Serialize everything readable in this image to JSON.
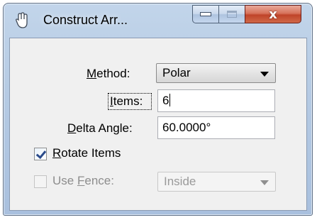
{
  "window": {
    "title": "Construct Arr...",
    "close_glyph": "x"
  },
  "form": {
    "method_label": "ethod:",
    "method_label_mnemonic": "M",
    "method_value": "Polar",
    "items_label": "tems:",
    "items_label_mnemonic": "I",
    "items_value": "6",
    "delta_label": "elta Angle:",
    "delta_label_mnemonic": "D",
    "delta_value": "60.0000°",
    "rotate_label": "otate Items",
    "rotate_label_mnemonic": "R",
    "rotate_checked": true,
    "fence_label_prefix": "Use ",
    "fence_label_mnemonic": "F",
    "fence_label_suffix": "ence:",
    "fence_checked": false,
    "fence_value": "Inside"
  },
  "icons": {
    "app": "hand-icon",
    "minimize": "minimize-icon",
    "maximize": "maximize-icon",
    "close": "close-icon",
    "dropdown": "chevron-down-icon"
  }
}
